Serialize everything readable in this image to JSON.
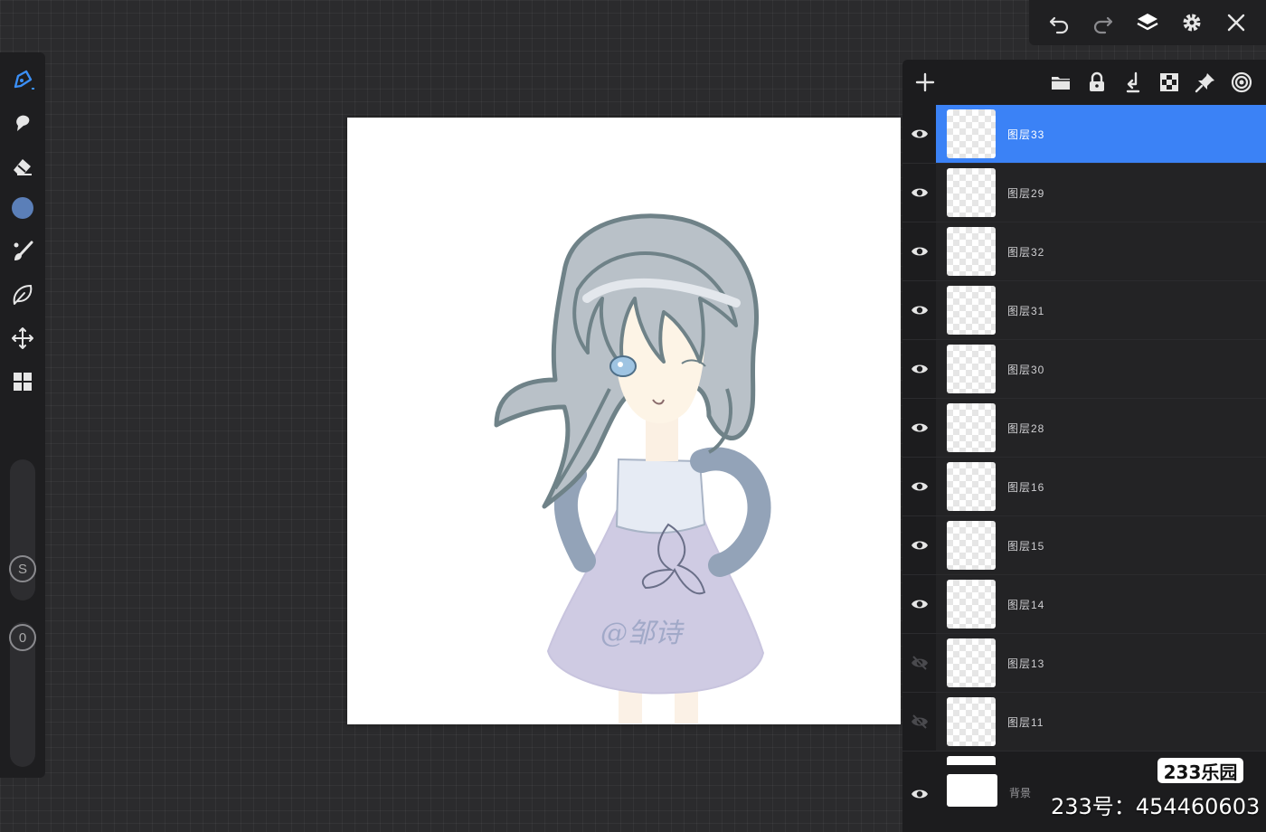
{
  "toolbar": {
    "icons": [
      "undo-icon",
      "redo-icon",
      "layers-icon",
      "settings-icon",
      "close-icon"
    ]
  },
  "left_tools": {
    "icons": [
      "pen-icon",
      "smudge-icon",
      "eraser-icon",
      "color-icon",
      "brush-icon",
      "lasso-icon",
      "transform-icon",
      "gallery-icon"
    ],
    "color": "#5b7fb8",
    "size_slider_label": "S",
    "opacity_slider_label": "0"
  },
  "canvas": {
    "signature": "@邹诗"
  },
  "layers_panel": {
    "header_icons": [
      "add-layer-icon",
      "folder-icon",
      "lock-icon",
      "merge-down-icon",
      "alpha-lock-icon",
      "pin-icon",
      "blend-icon"
    ],
    "layers": [
      {
        "name": "图层33",
        "visible": true,
        "selected": true
      },
      {
        "name": "图层29",
        "visible": true,
        "selected": false
      },
      {
        "name": "图层32",
        "visible": true,
        "selected": false
      },
      {
        "name": "图层31",
        "visible": true,
        "selected": false
      },
      {
        "name": "图层30",
        "visible": true,
        "selected": false
      },
      {
        "name": "图层28",
        "visible": true,
        "selected": false
      },
      {
        "name": "图层16",
        "visible": true,
        "selected": false
      },
      {
        "name": "图层15",
        "visible": true,
        "selected": false
      },
      {
        "name": "图层14",
        "visible": true,
        "selected": false
      },
      {
        "name": "图层13",
        "visible": false,
        "selected": false
      },
      {
        "name": "图层11",
        "visible": false,
        "selected": false
      }
    ],
    "background_layer": {
      "name": "背景",
      "visible": true
    }
  },
  "watermark": {
    "badge": "233乐园",
    "account": "233号：454460603"
  },
  "colors": {
    "accent": "#3b82f6",
    "panel": "#1c1c1e"
  }
}
